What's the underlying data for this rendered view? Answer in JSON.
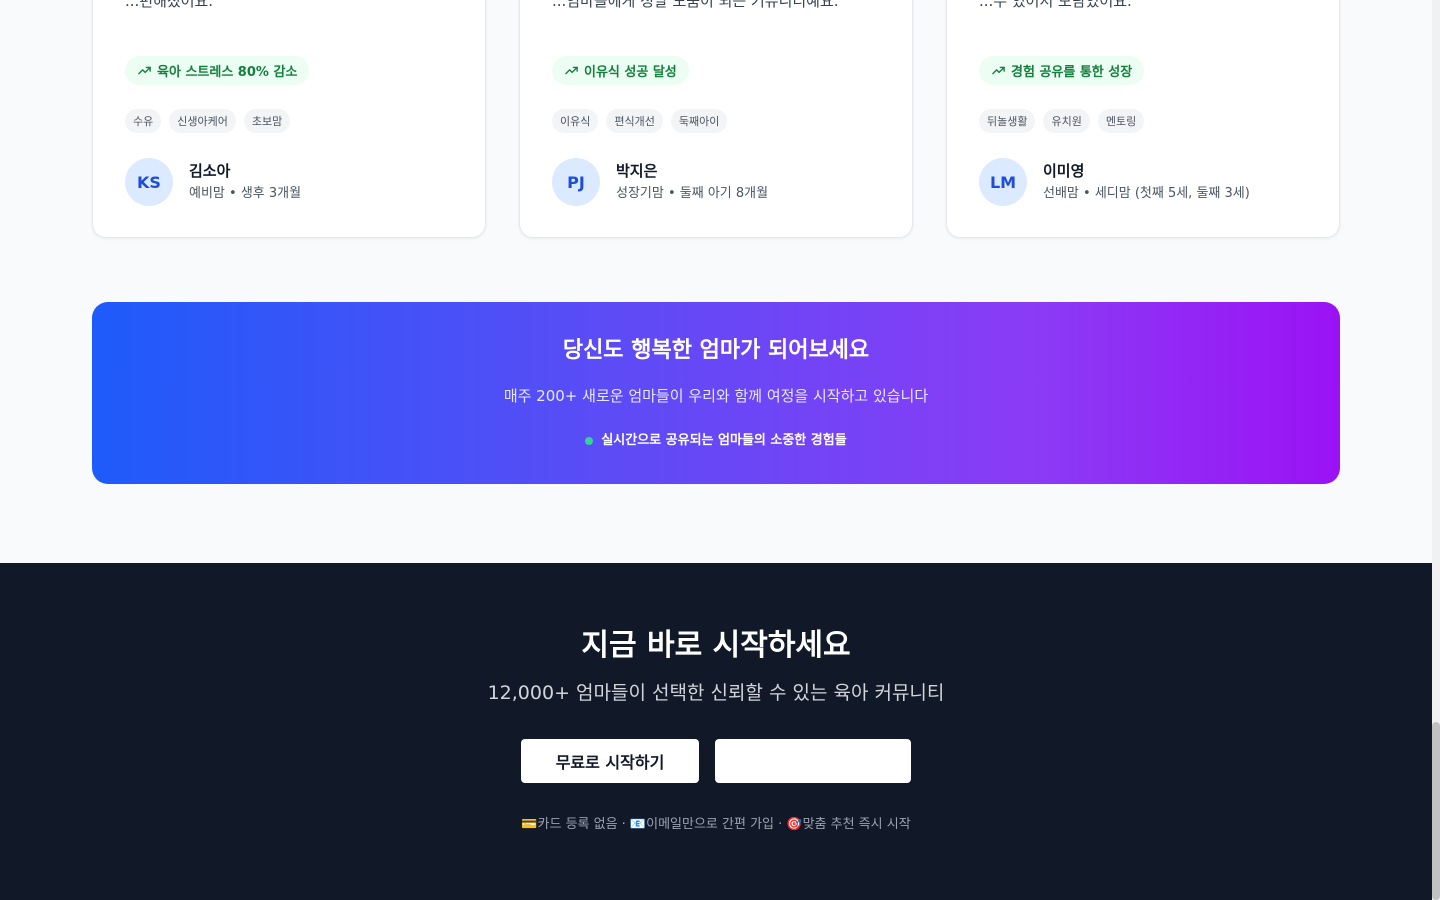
{
  "testimonials": [
    {
      "quote": "...편해졌어요.\"",
      "highlight": "육아 스트레스 80% 감소",
      "tags": [
        "수유",
        "신생아케어",
        "초보맘"
      ],
      "initials": "KS",
      "name": "김소아",
      "meta": "예비맘 • 생후 3개월"
    },
    {
      "quote": "...엄마들에게 정말 도움이 되는 커뮤니티예요.\"",
      "highlight": "이유식 성공 달성",
      "tags": [
        "이유식",
        "편식개선",
        "둑째아이"
      ],
      "initials": "PJ",
      "name": "박지은",
      "meta": "성장기맘 • 둘째 아기 8개월"
    },
    {
      "quote": "...수 있어서 보람있어요.\"",
      "highlight": "경험 공유를 통한 성장",
      "tags": [
        "뒤놀생활",
        "유치원",
        "멘토링"
      ],
      "initials": "LM",
      "name": "이미영",
      "meta": "선배맘 • 세디맘 (첫째 5세, 둘째 3세)"
    }
  ],
  "banner": {
    "title": "당신도 행복한 엄마가 되어보세요",
    "subtitle": "매주 200+ 새로운 엄마들이 우리와 함께 여정을 시작하고 있습니다",
    "live_text": "실시간으로 공유되는 엄마들의 소중한 경험들"
  },
  "cta": {
    "title": "지금 바로 시작하세요",
    "subtitle": "12,000+ 엄마들이 선택한 신뢰할 수 있는 육아 커뮤니티",
    "primary_label": "무료로 시작하기",
    "secondary_label": "",
    "note": "💳카드 등록 없음 · 📧이메일만으로 간편 가입 · 🎯맞춤 추천 즉시 시작"
  },
  "colors": {
    "accent_green": "#15803d",
    "avatar_blue": "#1d4ed8",
    "banner_start": "#1e5bfa",
    "banner_end": "#9b12f5",
    "dark_bg": "#111827"
  },
  "icons": {
    "highlight": "trending-up-icon"
  }
}
